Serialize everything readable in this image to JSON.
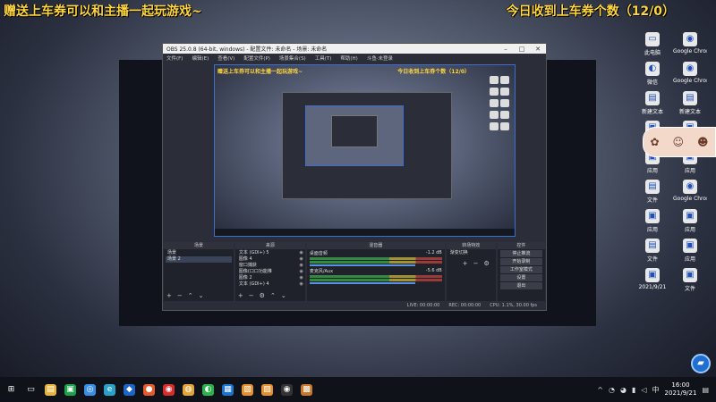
{
  "overlay": {
    "title": "赠送上车券可以和主播一起玩游戏~",
    "counter": "今日收到上车券个数（12/0）"
  },
  "obs": {
    "window_title": "OBS 25.0.8 (64-bit, windows) - 配置文件: 未命名 - 场景: 未命名",
    "menu": [
      "文件(F)",
      "编辑(E)",
      "查看(V)",
      "配置文件(P)",
      "场景集合(S)",
      "工具(T)",
      "帮助(H)",
      "斗鱼·未登录"
    ],
    "preview_title": "赠送上车券可以和主播一起玩游戏~",
    "preview_counter": "今日收到上车券个数（12/0）",
    "docks": {
      "scenes_label": "场景",
      "scenes": [
        "场景",
        "场景 2"
      ],
      "sources_label": "来源",
      "sources": [
        "文本 (GDI+) 5",
        "图像 4",
        "窗口捕获",
        "图像(口口功能推",
        "图像 2",
        "文本 (GDI+) 4"
      ],
      "mixer_label": "混音器",
      "mixer_tracks": [
        {
          "name": "桌面音频",
          "level": "-1.2 dB"
        },
        {
          "name": "麦克风/Aux",
          "level": "-5.6 dB"
        }
      ],
      "transitions_label": "转场特效",
      "transition_value": "渐变切换",
      "controls_label": "控件",
      "controls": [
        "停止推流",
        "开始录制",
        "工作室模式",
        "设置",
        "退出"
      ]
    },
    "status": {
      "live": "LIVE: 00:00:00",
      "rec": "REC: 00:00:00",
      "cpu": "CPU: 1.1%, 30.00 fps"
    }
  },
  "desktop_icons": [
    {
      "icon": "computer-icon",
      "label": "此电脑"
    },
    {
      "icon": "chrome-icon",
      "label": "Google Chrome"
    },
    {
      "icon": "wechat-icon",
      "label": "微信"
    },
    {
      "icon": "chrome-icon",
      "label": "Google Chrome"
    },
    {
      "icon": "file-icon",
      "label": "新建文本"
    },
    {
      "icon": "file-icon",
      "label": "新建文本"
    },
    {
      "icon": "app-icon",
      "label": "应用"
    },
    {
      "icon": "app-icon",
      "label": "应用"
    },
    {
      "icon": "app-icon",
      "label": "应用"
    },
    {
      "icon": "app-icon",
      "label": "应用"
    },
    {
      "icon": "file-icon",
      "label": "文件"
    },
    {
      "icon": "chrome-icon",
      "label": "Google Chrome"
    },
    {
      "icon": "app-icon",
      "label": "应用"
    },
    {
      "icon": "app-icon",
      "label": "应用"
    },
    {
      "icon": "file-icon",
      "label": "文件"
    },
    {
      "icon": "app-icon",
      "label": "应用"
    },
    {
      "icon": "app-icon",
      "label": "2021/9/21"
    },
    {
      "icon": "app-icon",
      "label": "文件"
    }
  ],
  "taskbar": {
    "time": "16:00",
    "date": "2021/9/21"
  }
}
